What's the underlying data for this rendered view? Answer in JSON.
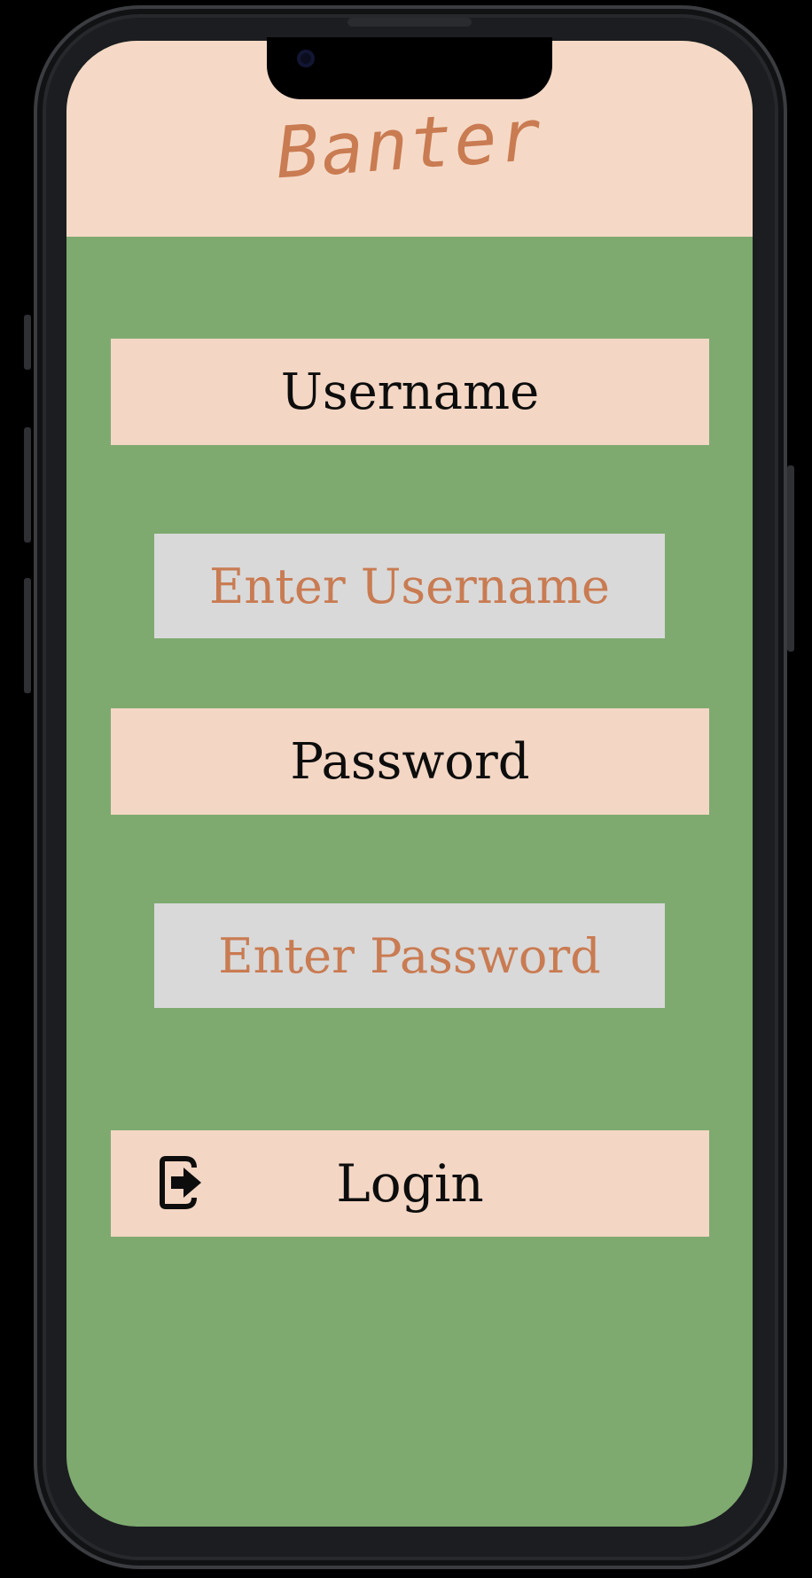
{
  "app": {
    "title": "Banter"
  },
  "form": {
    "username_label": "Username",
    "username_placeholder": "Enter Username",
    "password_label": "Password",
    "password_placeholder": "Enter Password",
    "login_label": "Login"
  },
  "icons": {
    "login": "login-icon"
  },
  "colors": {
    "background": "#7eaa70",
    "header": "#f5d9c6",
    "label_box": "#f3d6c4",
    "input_box": "#d9d9d9",
    "accent_text": "#c97b52"
  }
}
